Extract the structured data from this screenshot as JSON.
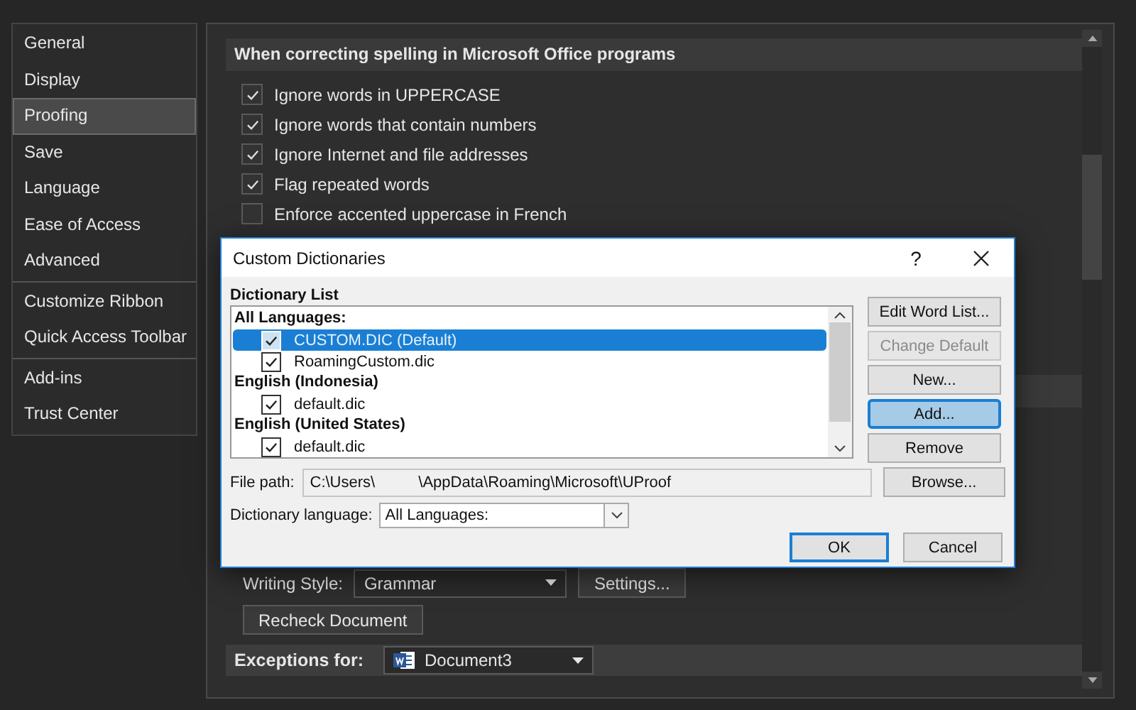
{
  "sidebar": {
    "groups": [
      [
        {
          "label": "General",
          "selected": false
        },
        {
          "label": "Display",
          "selected": false
        },
        {
          "label": "Proofing",
          "selected": true
        },
        {
          "label": "Save",
          "selected": false
        },
        {
          "label": "Language",
          "selected": false
        },
        {
          "label": "Ease of Access",
          "selected": false
        },
        {
          "label": "Advanced",
          "selected": false
        }
      ],
      [
        {
          "label": "Customize Ribbon",
          "selected": false
        },
        {
          "label": "Quick Access Toolbar",
          "selected": false
        }
      ],
      [
        {
          "label": "Add-ins",
          "selected": false
        },
        {
          "label": "Trust Center",
          "selected": false
        }
      ]
    ]
  },
  "main": {
    "section_title": "When correcting spelling in Microsoft Office programs",
    "options": [
      {
        "label": "Ignore words in UPPERCASE",
        "checked": true
      },
      {
        "label": "Ignore words that contain numbers",
        "checked": true
      },
      {
        "label": "Ignore Internet and file addresses",
        "checked": true
      },
      {
        "label": "Flag repeated words",
        "checked": true
      },
      {
        "label": "Enforce accented uppercase in French",
        "checked": false
      }
    ],
    "writing_style": {
      "label": "Writing Style:",
      "value": "Grammar"
    },
    "settings_button": "Settings...",
    "recheck_button": "Recheck Document",
    "exceptions": {
      "label": "Exceptions for:",
      "value": "Document3"
    }
  },
  "dialog": {
    "title": "Custom Dictionaries",
    "help": "?",
    "list_label": "Dictionary List",
    "groups": [
      {
        "heading": "All Languages:",
        "items": [
          {
            "name": "CUSTOM.DIC (Default)",
            "checked": true,
            "selected": true
          },
          {
            "name": "RoamingCustom.dic",
            "checked": true,
            "selected": false
          }
        ]
      },
      {
        "heading": "English (Indonesia)",
        "items": [
          {
            "name": "default.dic",
            "checked": true,
            "selected": false
          }
        ]
      },
      {
        "heading": "English (United States)",
        "items": [
          {
            "name": "default.dic",
            "checked": true,
            "selected": false
          }
        ]
      }
    ],
    "side_buttons": [
      {
        "label": "Edit Word List...",
        "disabled": false,
        "focused": false
      },
      {
        "label": "Change Default",
        "disabled": true,
        "focused": false
      },
      {
        "label": "New...",
        "disabled": false,
        "focused": false
      },
      {
        "label": "Add...",
        "disabled": false,
        "focused": true
      },
      {
        "label": "Remove",
        "disabled": false,
        "focused": false
      }
    ],
    "file_path": {
      "label": "File path:",
      "value": "C:\\Users\\          \\AppData\\Roaming\\Microsoft\\UProof"
    },
    "browse_button": "Browse...",
    "language": {
      "label": "Dictionary language:",
      "value": "All Languages:"
    },
    "ok_button": {
      "label": "OK",
      "default": true
    },
    "cancel_button": {
      "label": "Cancel",
      "default": false
    }
  }
}
